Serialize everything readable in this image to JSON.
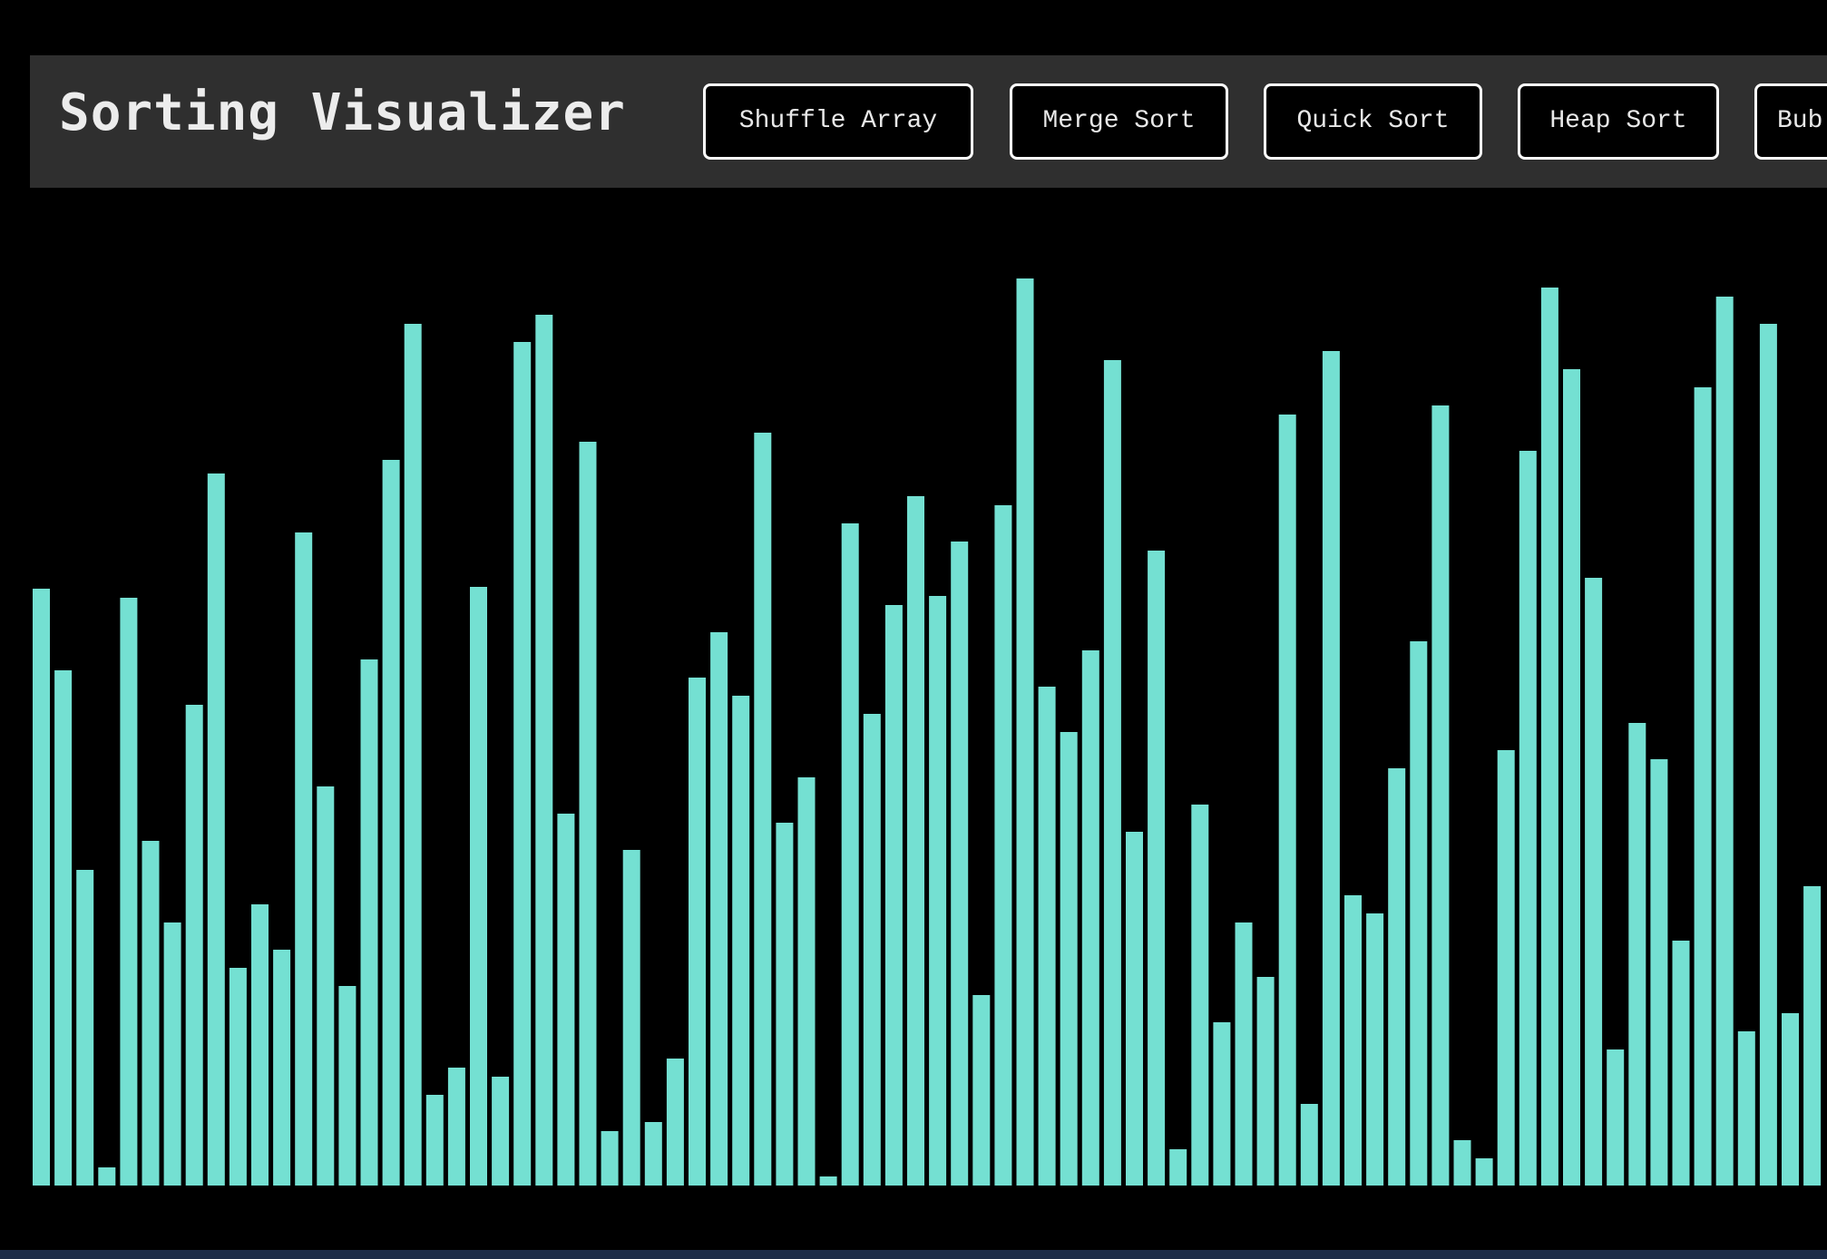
{
  "navbar": {
    "title": "Sorting Visualizer",
    "buttons": {
      "shuffle": "Shuffle Array",
      "merge": "Merge Sort",
      "quick": "Quick Sort",
      "heap": "Heap Sort",
      "bubble": "Bub"
    }
  },
  "colors": {
    "bar": "#74e0d2",
    "background": "#000000",
    "navbar": "#2f2f2f"
  },
  "chart_data": {
    "type": "bar",
    "values": [
      658,
      568,
      348,
      20,
      648,
      380,
      290,
      530,
      785,
      240,
      310,
      260,
      720,
      440,
      220,
      580,
      800,
      950,
      100,
      130,
      660,
      120,
      930,
      960,
      410,
      820,
      60,
      370,
      70,
      140,
      560,
      610,
      540,
      830,
      400,
      450,
      10,
      730,
      520,
      640,
      760,
      650,
      710,
      210,
      750,
      1000,
      550,
      500,
      590,
      910,
      390,
      700,
      40,
      420,
      180,
      290,
      230,
      850,
      90,
      920,
      320,
      300,
      460,
      600,
      860,
      50,
      30,
      480,
      810,
      990,
      900,
      670,
      150,
      510,
      470,
      270,
      880,
      980,
      170,
      950,
      190,
      330
    ],
    "ylim": [
      0,
      1000
    ]
  }
}
